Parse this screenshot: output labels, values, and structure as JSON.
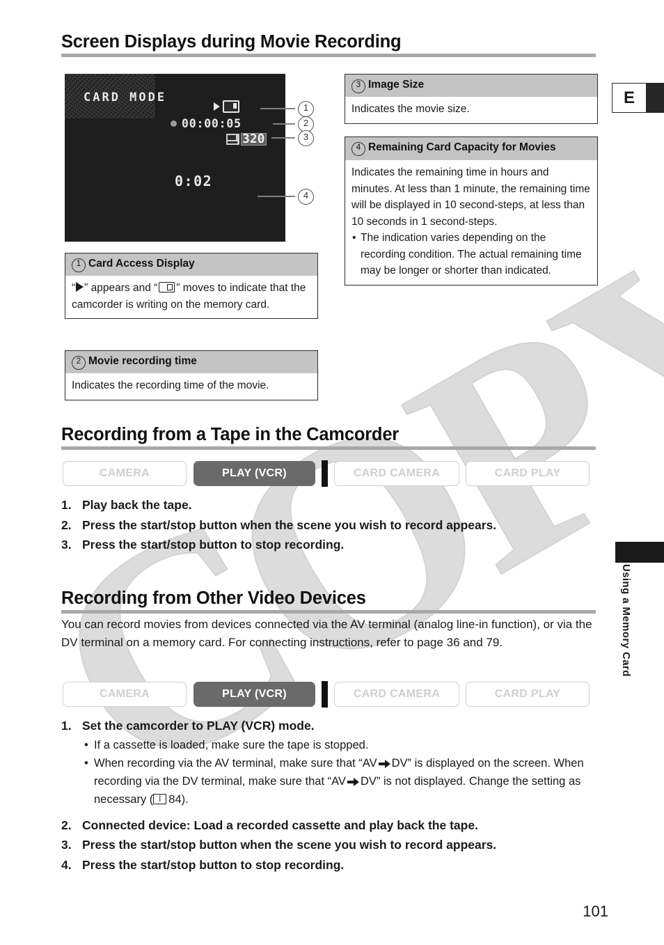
{
  "page": {
    "number": "101",
    "language_tab": "E",
    "side_label": "Using a Memory Card"
  },
  "sections": {
    "screen_displays": {
      "heading": "Screen Displays during Movie Recording",
      "screen": {
        "mode_label": "CARD MODE",
        "recording_time": "00:00:05",
        "image_size": "320",
        "remaining": "0:02",
        "access_icon": "play-triangle-card-icon",
        "rec_dot_icon": "record-dot-icon",
        "movie_icon": "movie-size-icon"
      },
      "callouts": [
        "1",
        "2",
        "3",
        "4"
      ],
      "boxes": [
        {
          "num": "1",
          "title": "Card Access Display",
          "body_prefix": "“",
          "body_mid": "” appears and “",
          "body_suffix": "” moves to indicate that the camcorder is writing on the memory card."
        },
        {
          "num": "2",
          "title": "Movie recording time",
          "body": "Indicates the recording time of the movie."
        },
        {
          "num": "3",
          "title": "Image Size",
          "body": "Indicates the movie size."
        },
        {
          "num": "4",
          "title": "Remaining Card Capacity for Movies",
          "body": "Indicates the remaining time in hours and minutes. At less than 1 minute, the remaining time will be displayed in 10 second-steps, at less than 10 seconds in 1 second-steps.",
          "bullets": [
            "The indication varies depending on the recording condition. The actual remaining time may be longer or shorter than indicated."
          ]
        }
      ]
    },
    "recording_from_tape": {
      "heading": "Recording from a Tape in the Camcorder",
      "modes": [
        {
          "label": "CAMERA",
          "active": false
        },
        {
          "label": "PLAY (VCR)",
          "active": true
        },
        {
          "label": "CARD CAMERA",
          "active": false
        },
        {
          "label": "CARD PLAY",
          "active": false
        }
      ],
      "steps": [
        {
          "num": "1.",
          "text": "Play back the tape."
        },
        {
          "num": "2.",
          "text": "Press the start/stop button when the scene you wish to record appears."
        },
        {
          "num": "3.",
          "text": "Press the start/stop button to stop recording."
        }
      ]
    },
    "recording_from_other": {
      "heading": "Recording from Other Video Devices",
      "intro": "You can record movies from devices connected via the AV terminal (analog line-in function), or via the DV terminal on a memory card. For connecting instructions, refer to page 36 and 79.",
      "modes": [
        {
          "label": "CAMERA",
          "active": false
        },
        {
          "label": "PLAY (VCR)",
          "active": true
        },
        {
          "label": "CARD CAMERA",
          "active": false
        },
        {
          "label": "CARD PLAY",
          "active": false
        }
      ],
      "steps": [
        {
          "num": "1.",
          "text": "Set the camcorder to PLAY (VCR) mode.",
          "bullets": {
            "b1": "If a cassette is loaded, make sure the tape is stopped.",
            "b2_a": "When recording via the AV terminal, make sure that “AV",
            "b2_b": "DV” is displayed on the screen. When recording via the DV terminal, make sure that “AV",
            "b2_c": "DV” is not displayed. Change the setting as necessary (",
            "b2_page": "84).",
            "b2_book_icon": "book-icon"
          }
        },
        {
          "num": "2.",
          "text": "Connected device: Load a recorded cassette and play back the tape."
        },
        {
          "num": "3.",
          "text": "Press the start/stop button when the scene you wish to record appears."
        },
        {
          "num": "4.",
          "text": "Press the start/stop button to stop recording."
        }
      ]
    }
  },
  "watermark": {
    "text": "COPY"
  },
  "colors": {
    "heading_rule": "#a8a8a8",
    "box_header_bg": "#c4c4c4",
    "mode_active_bg": "#6a6a6a",
    "mode_inactive_border": "#d0d0d0",
    "screen_bg": "#1e1e1e",
    "watermark": "#dcdcdc"
  }
}
